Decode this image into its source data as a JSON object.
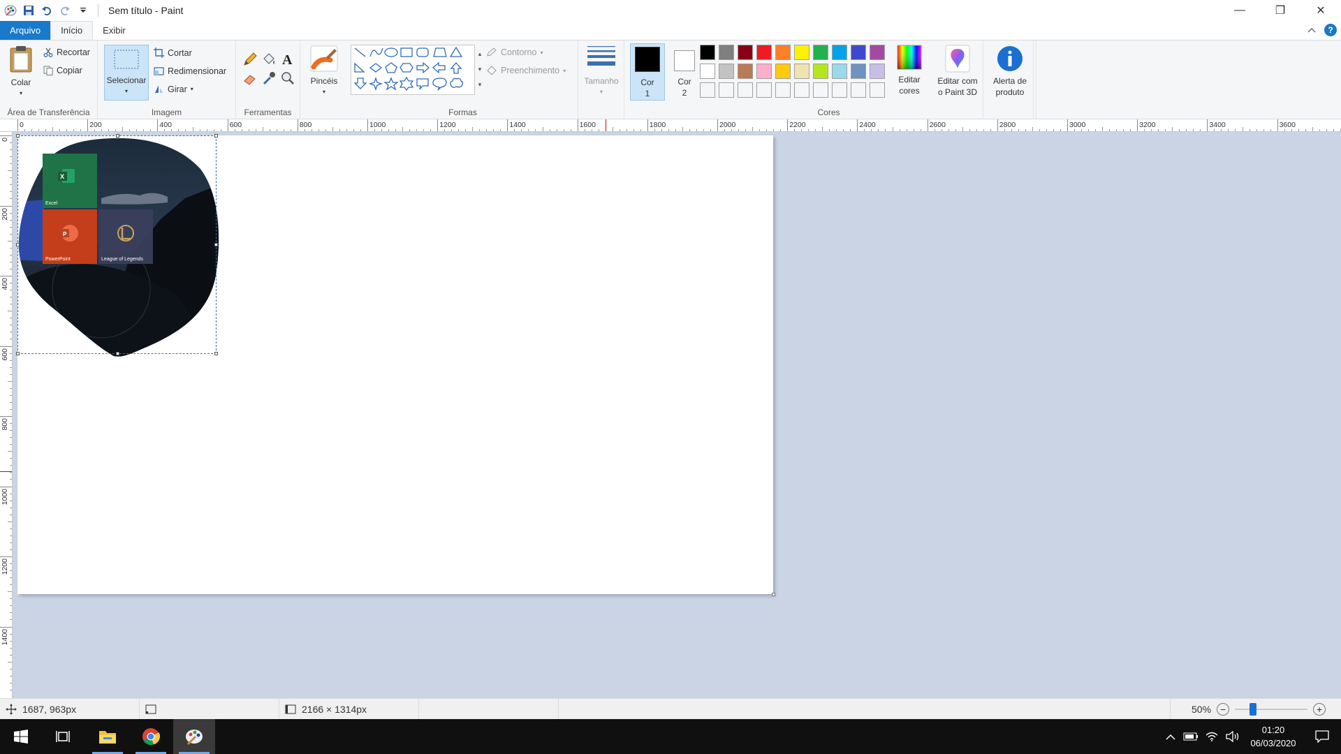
{
  "window": {
    "title": "Sem título - Paint",
    "controls": [
      "—",
      "❐",
      "✕"
    ]
  },
  "tabs": {
    "file": "Arquivo",
    "home": "Início",
    "view": "Exibir"
  },
  "clipboard": {
    "paste": "Colar",
    "cut": "Recortar",
    "copy": "Copiar",
    "label": "Área de Transferência"
  },
  "image": {
    "select": "Selecionar",
    "crop": "Cortar",
    "resize": "Redimensionar",
    "rotate": "Girar",
    "label": "Imagem"
  },
  "tools": {
    "label": "Ferramentas"
  },
  "brushes": {
    "label": "Pincéis"
  },
  "shapes": {
    "outline": "Contorno",
    "fill": "Preenchimento",
    "label": "Formas"
  },
  "size": {
    "label": "Tamanho"
  },
  "colors": {
    "color1_line1": "Cor",
    "color1_line2": "1",
    "color2_line1": "Cor",
    "color2_line2": "2",
    "edit_line1": "Editar",
    "edit_line2": "cores",
    "label": "Cores",
    "color1_value": "#000000",
    "color2_value": "#ffffff",
    "palette_row1": [
      "#000000",
      "#7f7f7f",
      "#880015",
      "#ed1c24",
      "#ff7f27",
      "#fff200",
      "#22b14c",
      "#00a2e8",
      "#3f48cc",
      "#a349a4"
    ],
    "palette_row2": [
      "#ffffff",
      "#c3c3c3",
      "#b97a57",
      "#ffaec9",
      "#ffc90e",
      "#efe4b0",
      "#b5e61d",
      "#99d9ea",
      "#7092be",
      "#c8bfe7"
    ]
  },
  "paint3d": {
    "line1": "Editar com",
    "line2": "o Paint 3D"
  },
  "product_alert": {
    "line1": "Alerta de",
    "line2": "produto"
  },
  "ruler": {
    "top_ticks": [
      "0",
      "200",
      "400",
      "600",
      "800",
      "1000",
      "1200",
      "1400",
      "1600",
      "1800",
      "2000",
      "2200",
      "2400",
      "2600",
      "2800",
      "3000",
      "3200",
      "3400",
      "3600"
    ],
    "left_ticks": [
      "0",
      "200",
      "400",
      "600",
      "800",
      "1000",
      "1200",
      "1400"
    ]
  },
  "tiles": {
    "excel": "Excel",
    "powerpoint": "PowerPoint",
    "lol": "League of Legends"
  },
  "status": {
    "cursor_pos": "1687, 963px",
    "image_size": "2166 × 1314px",
    "zoom": "50%"
  },
  "clock": {
    "time": "01:20",
    "date": "06/03/2020"
  }
}
